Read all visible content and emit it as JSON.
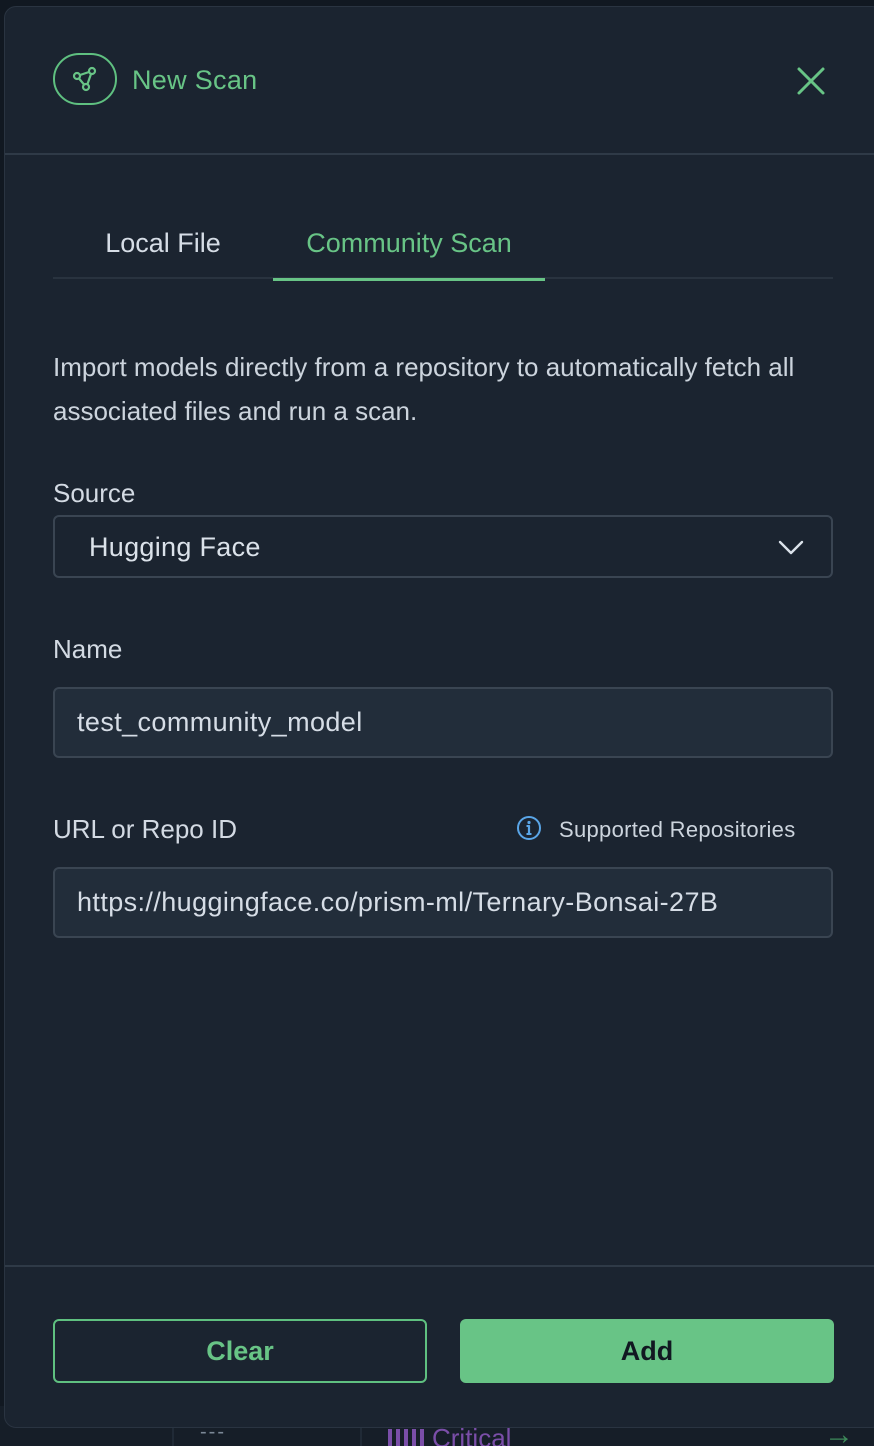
{
  "modal": {
    "title": "New Scan",
    "icon": "scan-graph-icon",
    "close_icon": "close-icon"
  },
  "tabs": [
    {
      "label": "Local File",
      "active": false
    },
    {
      "label": "Community Scan",
      "active": true
    }
  ],
  "description": "Import models directly from a repository to automatically fetch all associated files and run a scan.",
  "source": {
    "label": "Source",
    "selected": "Hugging Face"
  },
  "name": {
    "label": "Name",
    "value": "test_community_model"
  },
  "url": {
    "label": "URL or Repo ID",
    "value": "https://huggingface.co/prism-ml/Ternary-Bonsai-27B",
    "supported_link": "Supported Repositories",
    "supported_icon": "info-icon"
  },
  "footer": {
    "clear_label": "Clear",
    "add_label": "Add"
  },
  "background": {
    "cell_dash": "---",
    "severity": "Critical"
  },
  "colors": {
    "accent": "#68c486",
    "panel": "#1b2430",
    "input_bg": "#222d3a",
    "critical": "#7a4ea8"
  }
}
